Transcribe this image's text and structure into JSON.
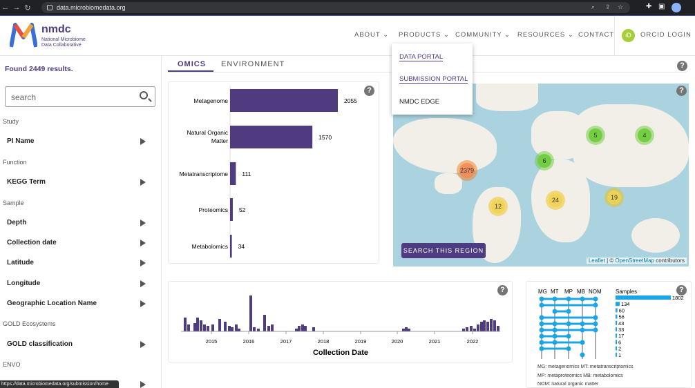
{
  "browser": {
    "url": "data.microbiomedata.org",
    "status_url": "https://data.microbiomedata.org/submission/home"
  },
  "logo": {
    "name": "nmdc",
    "subtitle_line1": "National Microbiome",
    "subtitle_line2": "Data Collaborative"
  },
  "nav": {
    "about": "ABOUT",
    "products": "PRODUCTS",
    "community": "COMMUNITY",
    "resources": "RESOURCES",
    "contact": "CONTACT",
    "orcid": "ORCID LOGIN",
    "orcid_badge": "iD"
  },
  "products_menu": {
    "data_portal": "DATA PORTAL",
    "submission_portal": "SUBMISSION PORTAL",
    "nmdc_edge": "NMDC EDGE"
  },
  "sidebar": {
    "results": "Found 2449 results.",
    "search_placeholder": "search",
    "sections": [
      {
        "title": "Study",
        "items": [
          "PI Name"
        ]
      },
      {
        "title": "Function",
        "items": [
          "KEGG Term"
        ]
      },
      {
        "title": "Sample",
        "items": [
          "Depth",
          "Collection date",
          "Latitude",
          "Longitude",
          "Geographic Location Name"
        ]
      },
      {
        "title": "GOLD Ecosystems",
        "items": [
          "GOLD classification"
        ]
      },
      {
        "title": "ENVO",
        "items": [
          ""
        ]
      }
    ]
  },
  "tabs": {
    "omics": "OMICS",
    "environment": "ENVIRONMENT"
  },
  "omics_chart": {
    "categories": [
      "Metagenome",
      "Natural Organic Matter",
      "Metatranscriptome",
      "Proteomics",
      "Metabolomics"
    ],
    "labels": [
      "2055",
      "1570",
      "111",
      "52",
      "34"
    ],
    "values": [
      2055,
      1570,
      111,
      52,
      34
    ],
    "color": "#4f3b80"
  },
  "map": {
    "search_region": "SEARCH THIS REGION",
    "attribution_leaflet": "Leaflet",
    "attribution_sep": " | © ",
    "attribution_osm": "OpenStreetMap",
    "attribution_contrib": " contributors",
    "clusters": [
      "2379",
      "5",
      "4",
      "6",
      "12",
      "24",
      "19"
    ]
  },
  "timeline": {
    "xlabel": "Collection Date",
    "ticks": [
      "2015",
      "2016",
      "2017",
      "2018",
      "2019",
      "2020",
      "2021",
      "2022"
    ]
  },
  "upset": {
    "columns": [
      "MG",
      "MT",
      "MP",
      "MB",
      "NOM"
    ],
    "samples_label": "Samples",
    "counts": [
      "1802",
      "134",
      "60",
      "56",
      "43",
      "33",
      "17",
      "6",
      "2",
      "1"
    ],
    "legend1": "MG: metagenomics   MT: metatranscriptomics",
    "legend2": "MP: metaproteomics   MB: metabolomics",
    "legend3": "NOM: natural organic matter",
    "bar_color": "#1aa6e6"
  },
  "help_label": "?",
  "chart_data": [
    {
      "type": "bar",
      "title": "",
      "categories": [
        "Metagenome",
        "Natural Organic Matter",
        "Metatranscriptome",
        "Proteomics",
        "Metabolomics"
      ],
      "values": [
        2055,
        1570,
        111,
        52,
        34
      ],
      "xlabel": "",
      "ylabel": ""
    },
    {
      "type": "bar",
      "title": "",
      "xlabel": "Collection Date",
      "categories": [
        "2015",
        "2016",
        "2017",
        "2018",
        "2019",
        "2020",
        "2021",
        "2022"
      ]
    },
    {
      "type": "bar",
      "title": "",
      "ylabel": "Samples",
      "values": [
        1802,
        134,
        60,
        56,
        43,
        33,
        17,
        6,
        2,
        1
      ]
    }
  ]
}
